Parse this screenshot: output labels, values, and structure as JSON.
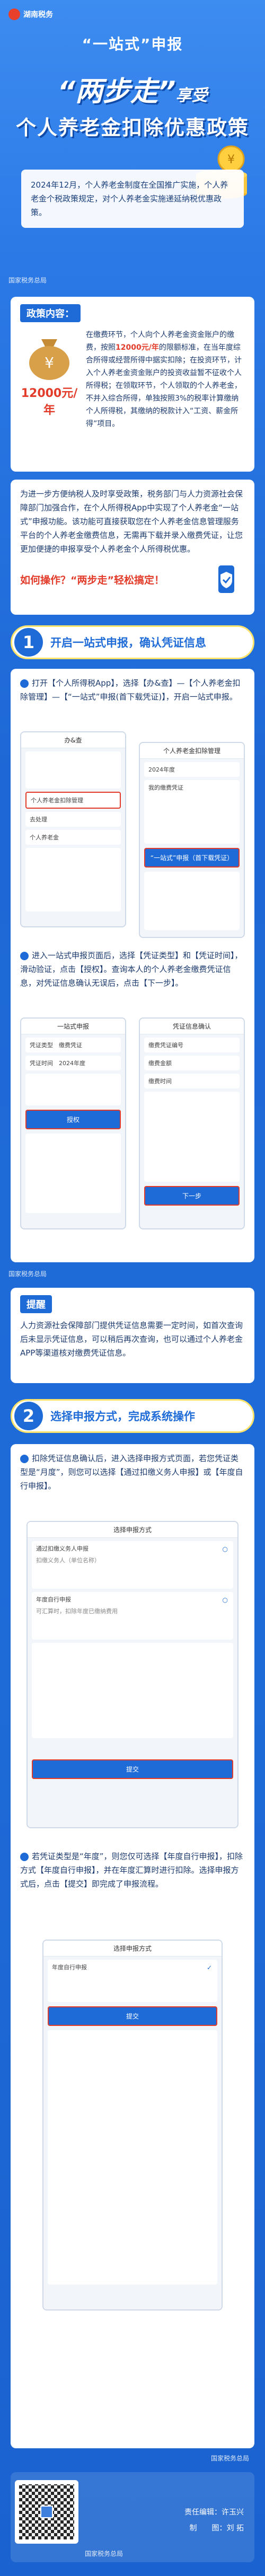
{
  "brand": {
    "name": "湖南税务"
  },
  "hero": {
    "one_stop": "“一站式”申报",
    "title_part1": "“两步走”",
    "title_part2": "享受",
    "title_line2": "个人养老金扣除优惠政策",
    "intro": "2024年12月，个人养老金制度在全国推广实施，个人养老金个税政策规定，对个人养老金实施递延纳税优惠政策。"
  },
  "watermarks": {
    "w1": "国家税务总局",
    "w2": "国家税务总局",
    "w3": "国家税务总局",
    "w4": "国家税务总局"
  },
  "policy": {
    "tag": "政策内容：",
    "amount": "12000元/年",
    "text_1": "在缴费环节，个人向个人养老金资金账户的缴费，按照",
    "text_hl": "12000元/年",
    "text_2": "的限额标准，在当年度综合所得或经营所得中据实扣除；在投资环节，计入个人养老金资金账户的投资收益暂不征收个人所得税；在领取环节，个人领取的个人养老金，不并入综合所得，单独按照3%的税率计算缴纳个人所得税，其缴纳的税款计入“工资、薪金所得”项目。"
  },
  "convenience": {
    "text": "为进一步方便纳税人及时享受政策，税务部门与人力资源社会保障部门加强合作，在个人所得税App中实现了个人养老金“一站式”申报功能。该功能可直接获取您在个人养老金信息管理服务平台的个人养老金缴费信息，无需再下载并录入缴费凭证，让您更加便捷的申报享受个人养老金个人所得税优惠。",
    "question": "如何操作？“两步走”轻松搞定！"
  },
  "step1": {
    "num": "1",
    "title": "开启一站式申报，确认凭证信息",
    "instr_a": "打开【个人所得税App】，选择【办&查】—【个人养老金扣除管理】—【“一站式”申报(首下载凭证)】，开启一站式申报。",
    "phone1": {
      "title": "办&查",
      "row1": "个人养老金扣除管理",
      "row2": "去处理",
      "row3": "个人养老金"
    },
    "phone2": {
      "title": "个人养老金扣除管理",
      "row1": "2024年度",
      "row2": "我的缴费凭证",
      "btn": "“一站式”申报（首下载凭证）"
    },
    "instr_b": "进入一站式申报页面后，选择【凭证类型】和【凭证时间】，滑动验证，点击【授权】。查询本人的个人养老金缴费凭证信息，对凭证信息确认无误后，点击【下一步】。",
    "phone3": {
      "title": "一站式申报",
      "type_label": "凭证类型",
      "type_value": "缴费凭证",
      "time_label": "凭证时间",
      "time_value": "2024年度",
      "auth": "授权"
    },
    "phone4": {
      "title": "凭证信息确认",
      "row1": "缴费凭证编号",
      "row2": "缴费金额",
      "row3": "缴费时间",
      "next": "下一步"
    }
  },
  "tip": {
    "tag": "提醒",
    "text": "人力资源社会保障部门提供凭证信息需要一定时间，如首次查询后未显示凭证信息，可以稍后再次查询，也可以通过个人养老金APP等渠道核对缴费凭证信息。"
  },
  "step2": {
    "num": "2",
    "title": "选择申报方式，完成系统操作",
    "instr_a": "扣除凭证信息确认后，进入选择申报方式页面，若您凭证类型是“月度”，则您可以选择【通过扣缴义务人申报】或【年度自行申报】。",
    "phone5": {
      "title": "选择申报方式",
      "opt1": "通过扣缴义务人申报",
      "opt1_sub": "扣缴义务人（单位名称）",
      "opt2": "年度自行申报",
      "opt2_sub": "可汇算时，扣除年度已缴纳费用",
      "submit": "提交"
    },
    "instr_b": "若凭证类型是“年度”，则您仅可选择【年度自行申报】，扣除方式【年度自行申报】，并在年度汇算时进行扣除。选择申报方式后，点击【提交】即完成了申报流程。",
    "phone6": {
      "title": "选择申报方式",
      "opt": "年度自行申报",
      "submit": "提交"
    }
  },
  "footer": {
    "editor": "责任编辑：许玉兴",
    "designer": "制　　图：刘 拓"
  }
}
